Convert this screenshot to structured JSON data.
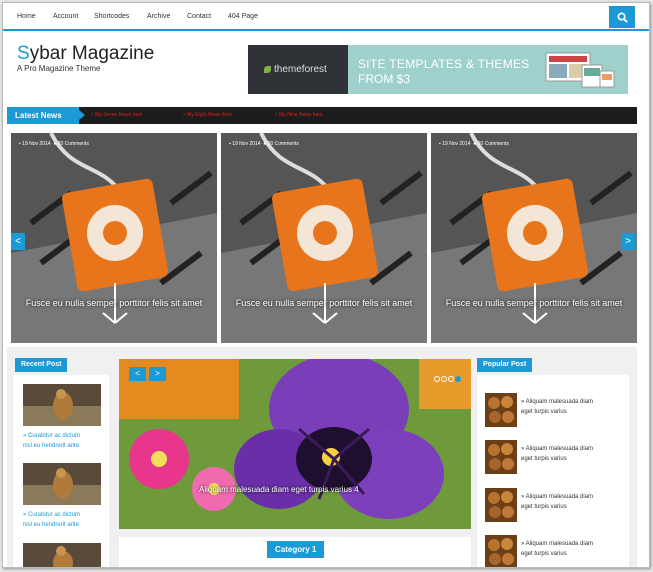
{
  "nav": {
    "items": [
      "Home",
      "Account",
      "Shortcodes",
      "Archive",
      "Contact",
      "404 Page"
    ]
  },
  "header": {
    "logo_first": "S",
    "logo_rest": "ybar Magazine",
    "tagline": "A Pro Magazine Theme"
  },
  "banner": {
    "brand": "themeforest",
    "line1": "SITE TEMPLATES & THEMES",
    "line2": "FROM $3"
  },
  "ticker": {
    "label": "Latest News",
    "items": [
      "My Seven News Item",
      "My Eight News Item",
      "My Nine News Item"
    ]
  },
  "slider": {
    "slides": [
      {
        "date": "19 Nov 2014",
        "comments": "20 Comments",
        "caption": "Fusce eu nulla semper porttitor felis sit amet"
      },
      {
        "date": "19 Nov 2014",
        "comments": "20 Comments",
        "caption": "Fusce eu nulla semper porttitor felis sit amet"
      },
      {
        "date": "19 Nov 2014",
        "comments": "20 Comments",
        "caption": "Fusce eu nulla semper porttitor felis sit amet"
      }
    ],
    "prev": "<",
    "next": ">"
  },
  "recent": {
    "title": "Recent Post",
    "posts": [
      {
        "line1": "» Curabitur ac dictum",
        "line2": "nisl eu hendrerit ante"
      },
      {
        "line1": "» Curabitur ac dictum",
        "line2": "nisl eu hendrerit ante"
      }
    ]
  },
  "feature": {
    "caption": "Aliquam malesuada diam eget turpis varius 4",
    "prev": "<",
    "next": ">"
  },
  "category": {
    "label": "Category 1"
  },
  "popular": {
    "title": "Popular Post",
    "posts": [
      {
        "line1": "» Aliquam malesuada diam",
        "line2": "eget turpis varius"
      },
      {
        "line1": "» Aliquam malesuada diam",
        "line2": "eget turpis varius"
      },
      {
        "line1": "» Aliquam malesuada diam",
        "line2": "eget turpis varius"
      },
      {
        "line1": "» Aliquam malesuada diam",
        "line2": "eget turpis varius"
      }
    ]
  },
  "colors": {
    "accent": "#1b9ad6",
    "dark": "#1c1c1c",
    "news_red": "#e02020"
  }
}
